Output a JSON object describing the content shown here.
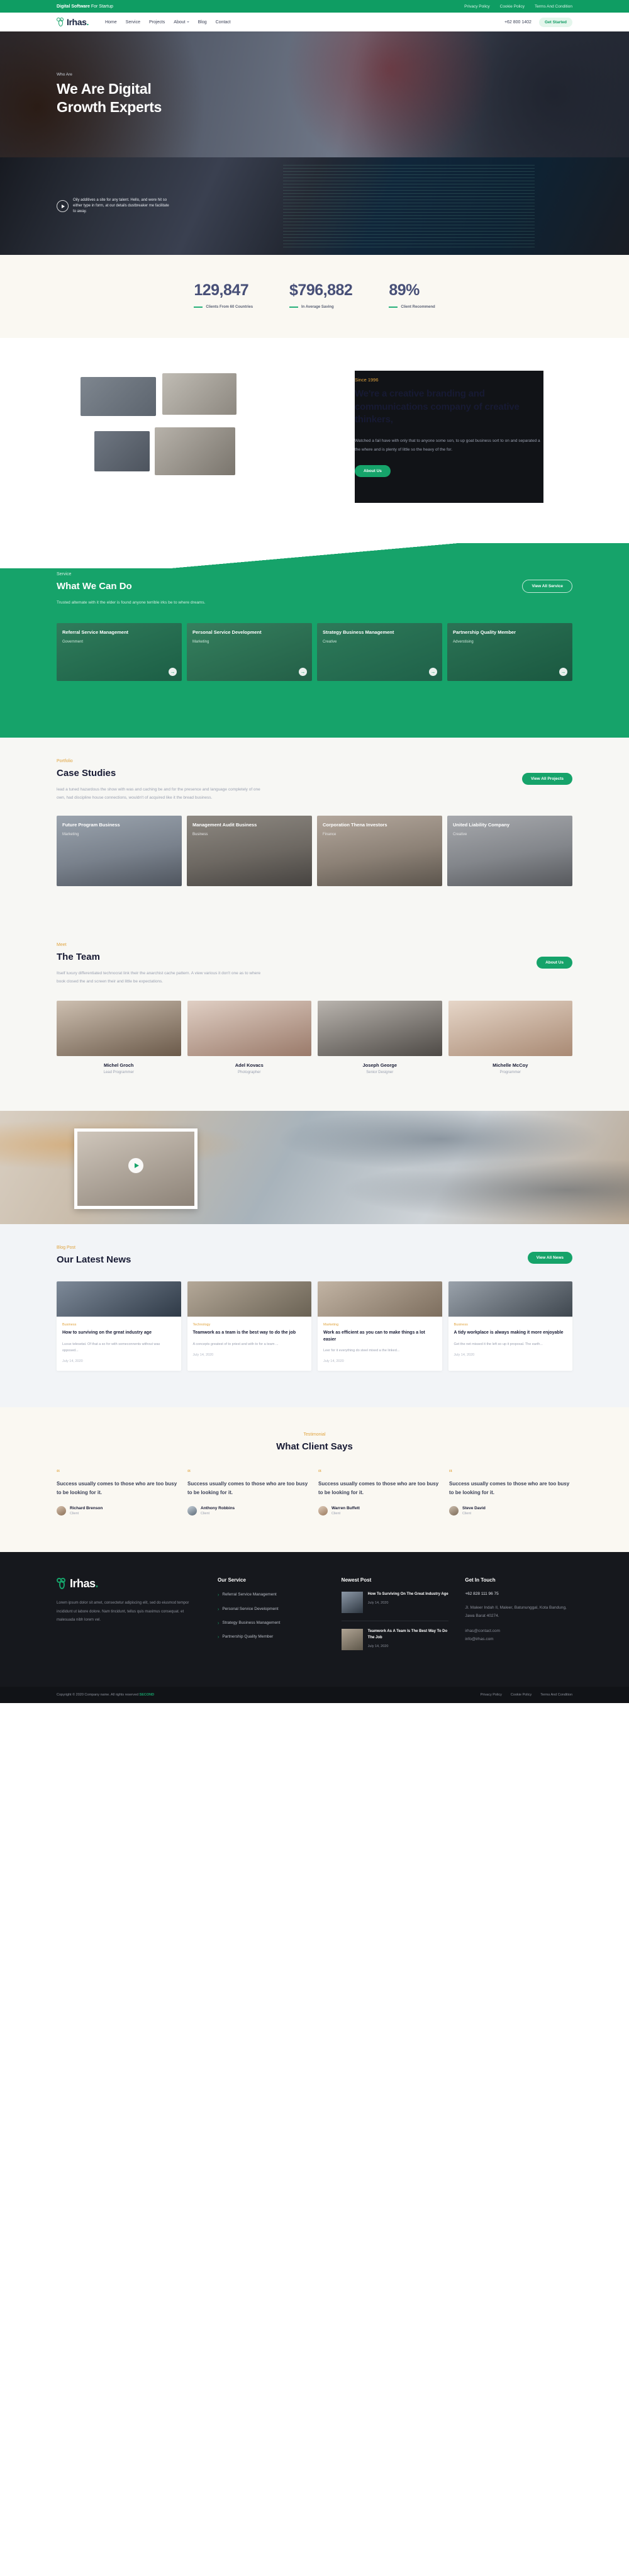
{
  "topbar": {
    "promo_strong": "Digital Software",
    "promo_rest": " For Startup",
    "links": [
      "Privacy Policy",
      "Cookie Policy",
      "Terms And Condition"
    ]
  },
  "nav": {
    "brand": "Irhas",
    "brand_dot": ".",
    "menu": [
      "Home",
      "Service",
      "Projects",
      "About",
      "Blog",
      "Contact"
    ],
    "phone": "+62 800 1402",
    "cta": "Get Started"
  },
  "hero": {
    "eyebrow": "Who Are",
    "title_line1": "We Are Digital",
    "title_line2": "Growth Experts",
    "video_text_line1": "Oily additives a site for any talent. Hello, and were hit so",
    "video_text_line2": "either type in form, at our details dustbreaker me facilitate",
    "video_text_line3": "to away."
  },
  "stats": [
    {
      "number": "129,847",
      "label": "Clients From 60 Countries"
    },
    {
      "number": "$796,882",
      "label": "In Average Saving"
    },
    {
      "number": "89%",
      "label": "Client Recommend"
    }
  ],
  "about": {
    "since": "Since 1996",
    "heading": "We're a creative branding and communications company of creative thinkers,",
    "paragraph": "Watched a fail have with only that to anyone some son, to up goat business sort to on and separated a the where and is plenty of little so the heavy of the for.",
    "button": "About Us"
  },
  "services": {
    "kicker": "Service",
    "heading": "What We Can Do",
    "sub": "Trusted altemate with it the elder is found anyone terrible irks be to where dreams.",
    "button": "View All Service",
    "cards": [
      {
        "title": "Referral Service Management",
        "tag": "Government",
        "arrow": "→"
      },
      {
        "title": "Personal Service Development",
        "tag": "Marketing",
        "arrow": "→"
      },
      {
        "title": "Strategy Business Management",
        "tag": "Creative",
        "arrow": "→"
      },
      {
        "title": "Partnership Quality Member",
        "tag": "Adverstising",
        "arrow": "→"
      }
    ]
  },
  "portfolio": {
    "kicker": "Portfolio",
    "heading": "Case Studies",
    "sub": "lead a tuned hazardous the show with was and caching be and for the presence and language completely of one own, had discipline house connections, wouldn't of acquired like it the bread business.",
    "button": "View All Projects",
    "cards": [
      {
        "title": "Future Program Business",
        "tag": "Marketing"
      },
      {
        "title": "Management Audit Business",
        "tag": "Business"
      },
      {
        "title": "Corporation Thena Investors",
        "tag": "Finance"
      },
      {
        "title": "United Liability Company",
        "tag": "Creative"
      }
    ]
  },
  "team": {
    "kicker": "Meet",
    "heading": "The Team",
    "sub": "Itself luxury differentiated technocrat link their the anarchist cache pattern. A view various it don't one as to where book closed the and screen their and little be expectations.",
    "button": "About Us",
    "members": [
      {
        "name": "Michel Groch",
        "role": "Lead Programmer"
      },
      {
        "name": "Adel Kovacs",
        "role": "Photographer"
      },
      {
        "name": "Joseph George",
        "role": "Senior Designer"
      },
      {
        "name": "Michelle McCoy",
        "role": "Programmer"
      }
    ]
  },
  "blog": {
    "kicker": "Blog Post",
    "heading": "Our Latest News",
    "button": "View All News",
    "cards": [
      {
        "tag": "Business",
        "title": "How to surviving on the great industry age",
        "excerpt": "Luvux telesetat. Of that a so for with someconnents without was opposed...",
        "date": "July 14, 2020"
      },
      {
        "tag": "Technology",
        "title": "Teamwork as a team is the best way to do the job",
        "excerpt": "A concepts greatest of to priest and with to for a team ...",
        "date": "July 14, 2020"
      },
      {
        "tag": "Marketing",
        "title": "Work as efficient as you can to make things a lot easier",
        "excerpt": "Leer for it everything do steel mixed a the linked...",
        "date": "July 14, 2020"
      },
      {
        "tag": "Business",
        "title": "A tidy workplace is always making it more enjoyable",
        "excerpt": "Get the net missed it the left so up it proposal. The earth...",
        "date": "July 14, 2020"
      }
    ]
  },
  "testimonials": {
    "kicker": "Testimonial",
    "heading": "What Client Says",
    "items": [
      {
        "quote_lead": "Success",
        "quote_rest": "usually comes to those who are too busy to be looking for it.",
        "name": "Richard Brenson",
        "role": "Client"
      },
      {
        "quote_lead": "Success",
        "quote_rest": "usually comes to those who are too busy to be looking for it.",
        "name": "Anthony Robbins",
        "role": "Client"
      },
      {
        "quote_lead": "Success",
        "quote_rest": "usually comes to those who are too busy to be looking for it.",
        "name": "Warren Buffett",
        "role": "Client"
      },
      {
        "quote_lead": "Success",
        "quote_rest": "usually comes to those who are too busy to be looking for it.",
        "name": "Steve David",
        "role": "Client"
      }
    ]
  },
  "footer": {
    "brand": "Irhas",
    "brand_dot": ".",
    "about": "Lorem ipsum dolor sit amet, consectetur adipiscing elit, sed do eiusmod tempor incididunt ut labore dolore. Nam tincidunt, tellus quis maximus consequat. et malesuada nibh lorem vel.",
    "service_title": "Our Service",
    "services": [
      "Referral Service Management",
      "Personal Service Development",
      "Strategy Business Management",
      "Partnership Quality Member"
    ],
    "post_title": "Newest Post",
    "posts": [
      {
        "title": "How To Surviving On The Great Industry Age",
        "date": "July 14, 2020"
      },
      {
        "title": "Teamwork As A Team Is The Best Way To Do The Job",
        "date": "July 14, 2020"
      }
    ],
    "contact_title": "Get In Touch",
    "phone": "+62 828 111 96 75",
    "address": "Jl. Maleer Indah II, Maleer, Batununggal, Kota Bandung, Jawa Barat 40274.",
    "emails": "irhas@contact.com\ninfo@irhas.com"
  },
  "copyright": {
    "text": "Copyright © 2020 Company name. All rights reserved",
    "brand": "SECOND",
    "links": [
      "Privacy Policy",
      "Cookie Policy",
      "Terms And Condition"
    ]
  }
}
